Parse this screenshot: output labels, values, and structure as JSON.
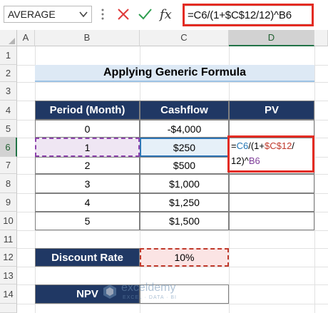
{
  "formula_bar": {
    "name_box": "AVERAGE",
    "cancel_icon": "close-icon",
    "enter_icon": "check-icon",
    "function_icon": "fx",
    "formula": "=C6/(1+$C$12/12)^B6"
  },
  "columns": [
    "A",
    "B",
    "C",
    "D"
  ],
  "rows": [
    "1",
    "2",
    "3",
    "4",
    "5",
    "6",
    "7",
    "8",
    "9",
    "10",
    "11",
    "12",
    "13",
    "14"
  ],
  "sheet": {
    "title": "Applying Generic Formula",
    "headers": {
      "period": "Period (Month)",
      "cashflow": "Cashflow",
      "pv": "PV"
    },
    "table": [
      {
        "period": "0",
        "cashflow": "-$4,000"
      },
      {
        "period": "1",
        "cashflow": "$250"
      },
      {
        "period": "2",
        "cashflow": "$500"
      },
      {
        "period": "3",
        "cashflow": "$1,000"
      },
      {
        "period": "4",
        "cashflow": "$1,250"
      },
      {
        "period": "5",
        "cashflow": "$1,500"
      }
    ],
    "pv_formula": {
      "eq": "=",
      "ref1": "C6",
      "mid1": "/(1+",
      "ref2": "$C$12",
      "tail": "/",
      "line2_start": "12)^",
      "ref3": "B6"
    },
    "discount_rate_label": "Discount Rate",
    "discount_rate_value": "10%",
    "npv_label": "NPV"
  },
  "watermark": {
    "brand": "exceldemy",
    "tagline": "EXCEL · DATA · BI"
  },
  "colors": {
    "header_fill": "#203864",
    "title_fill": "#dde9f5",
    "highlight_red": "#e32b22",
    "ref_blue": "#1f74b4",
    "ref_red": "#c0392b",
    "ref_purple": "#7d3c98"
  }
}
